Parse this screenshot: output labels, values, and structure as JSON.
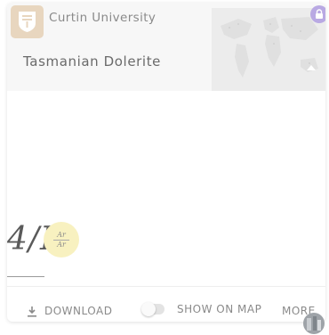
{
  "card": {
    "institution": "Curtin University",
    "title": "Tasmanian Dolerite",
    "formula_text": "4/F",
    "badge_top": "Ar",
    "badge_bottom": "Ar",
    "footer": {
      "download_label": "DOWNLOAD",
      "show_on_map_label": "SHOW ON MAP",
      "more_label": "MORE"
    }
  },
  "colors": {
    "lock_badge": "#b9a9e3",
    "logo_bg": "#e8d6bf",
    "formula_badge": "#f8f1c0"
  }
}
